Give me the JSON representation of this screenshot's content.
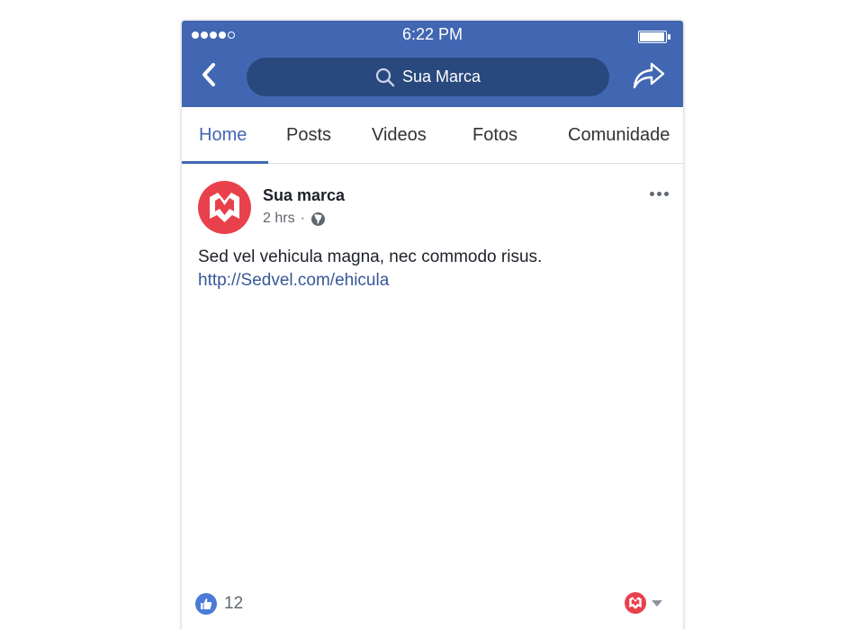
{
  "status_bar": {
    "time": "6:22 PM"
  },
  "header": {
    "search_text": "Sua Marca"
  },
  "tabs": [
    {
      "label": "Home",
      "active": true
    },
    {
      "label": "Posts",
      "active": false
    },
    {
      "label": "Videos",
      "active": false
    },
    {
      "label": "Fotos",
      "active": false
    },
    {
      "label": "Comunidade",
      "active": false
    }
  ],
  "post": {
    "author": "Sua marca",
    "time": "2 hrs",
    "separator": "·",
    "text": "Sed vel vehicula magna, nec commodo risus.",
    "link": "http://Sedvel.com/ehicula",
    "like_count": "12"
  },
  "colors": {
    "brand_blue": "#4267b2",
    "search_bg": "#29487d",
    "avatar_red": "#e9414b",
    "link_blue": "#385898"
  },
  "icons": [
    "back-arrow-icon",
    "search-icon",
    "share-icon",
    "globe-icon",
    "more-icon",
    "like-icon",
    "chevron-down-icon"
  ]
}
